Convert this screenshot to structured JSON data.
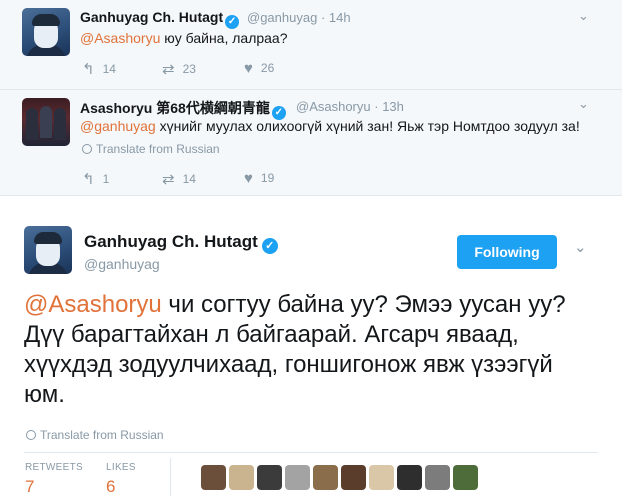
{
  "reply1": {
    "name": "Ganhuyag Ch. Hutagt",
    "handle": "@ganhuyag",
    "time": "· 14h",
    "mention": "@Asashoryu",
    "text": " юу байна, лалраа?",
    "replies": "14",
    "retweets": "23",
    "likes": "26"
  },
  "reply2": {
    "name": "Asashoryu 第68代横綱朝青龍",
    "handle": "@Asashoryu",
    "time": "· 13h",
    "mention": "@ganhuyag",
    "text": " хүнийг муулах олихоогүй хүний зан! Яьж тэр Номтдоо зодуул за!",
    "translate": "Translate from Russian",
    "replies": "1",
    "retweets": "14",
    "likes": "19"
  },
  "main": {
    "name": "Ganhuyag Ch. Hutagt",
    "handle": "@ganhuyag",
    "follow_label": "Following",
    "mention": "@Asashoryu",
    "text": " чи согтуу байна уу? Эмээ уусан уу? Дүү барагтайхан л байгаарай. Агсарч яваад, хүүхдэд зодуулчихаад, гоншигонож явж үзээгүй юм.",
    "translate": "Translate from Russian",
    "retweets_label": "RETWEETS",
    "retweets": "7",
    "likes_label": "LIKES",
    "likes": "6"
  },
  "icons": {
    "verified": "verified-badge-icon",
    "reply": "reply-icon",
    "retweet": "retweet-icon",
    "like": "heart-icon",
    "globe": "globe-icon",
    "caret": "chevron-down-icon"
  },
  "colors": {
    "accent": "#1da1f2",
    "mention": "#e0723a",
    "muted": "#8899a6"
  }
}
